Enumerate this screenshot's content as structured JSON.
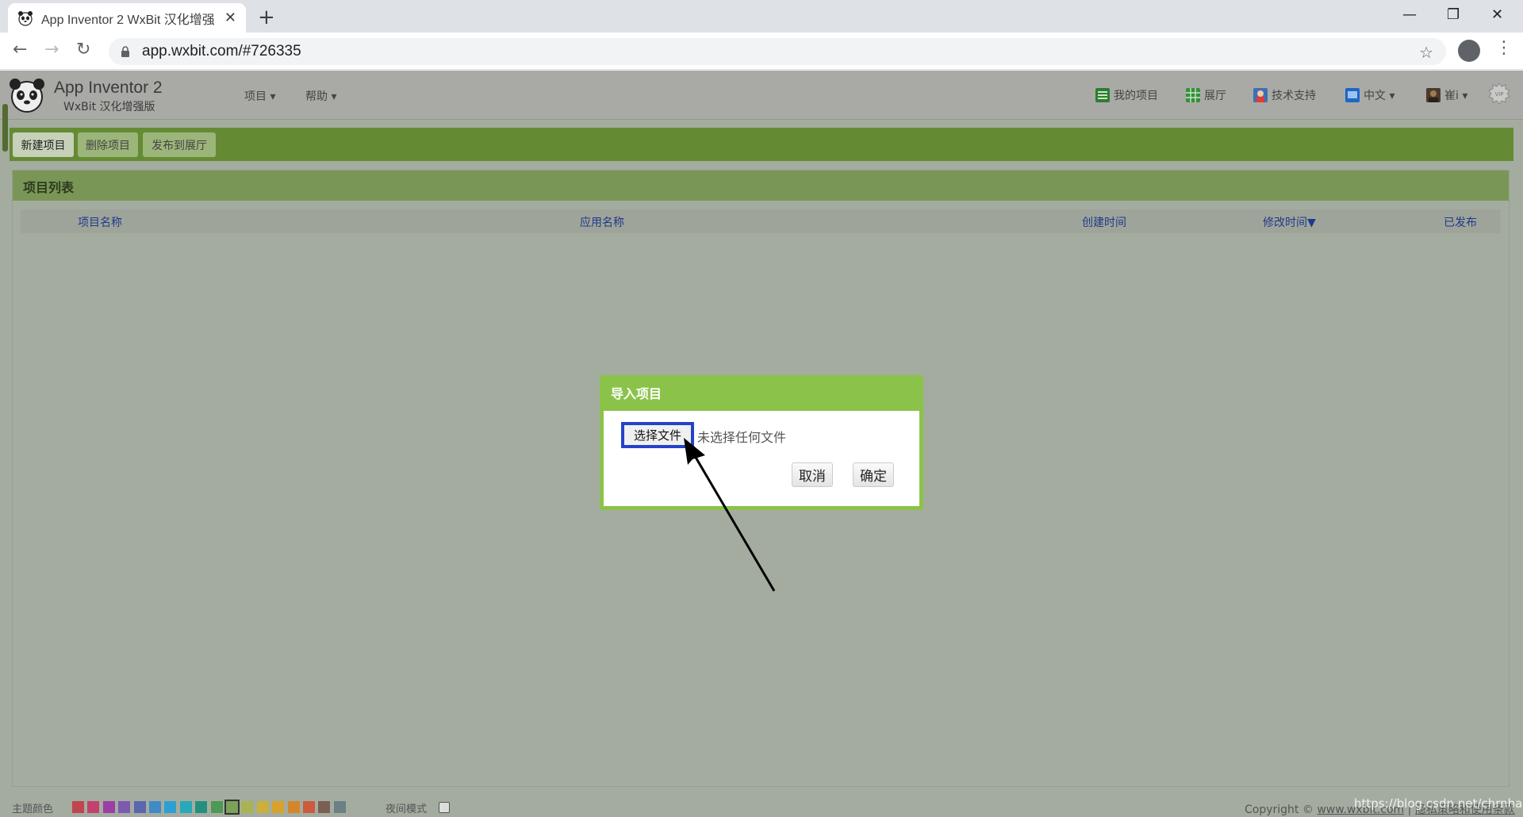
{
  "browser": {
    "tab_title": "App Inventor 2 WxBit 汉化增强",
    "url": "app.wxbit.com/#726335"
  },
  "app": {
    "name": "App Inventor 2",
    "subtitle": "WxBit 汉化增强版",
    "menu": [
      {
        "label": "项目 ▾"
      },
      {
        "label": "帮助 ▾"
      }
    ],
    "right_menu": {
      "my_projects": "我的项目",
      "gallery": "展厅",
      "support": "技术支持",
      "language": "中文 ▾",
      "user": "崔i ▾"
    }
  },
  "toolbar": {
    "new_project": "新建项目",
    "delete_project": "删除项目",
    "publish_gallery": "发布到展厅"
  },
  "project_list": {
    "title": "项目列表",
    "columns": {
      "name": "项目名称",
      "app_name": "应用名称",
      "created": "创建时间",
      "modified": "修改时间▼",
      "published": "已发布"
    }
  },
  "dialog": {
    "title": "导入项目",
    "choose_file": "选择文件",
    "file_status": "未选择任何文件",
    "cancel": "取消",
    "ok": "确定"
  },
  "footer": {
    "theme_label": "主题颜色",
    "night_label": "夜间模式",
    "theme_colors": [
      "#c0454f",
      "#c2416d",
      "#9b3fa6",
      "#7d59b0",
      "#5a66ad",
      "#3f8bc7",
      "#2e9fd3",
      "#26a9b8",
      "#23907f",
      "#4c9a54",
      "#7aa25a",
      "#a9b350",
      "#c9b13a",
      "#d8a32b",
      "#d4862a",
      "#cc5b3c",
      "#7a5f55",
      "#6c8086"
    ],
    "copyright_prefix": "Copyright ©",
    "copyright_link": "www.wxbit.com",
    "copyright_sep": "|",
    "copyright_terms": "隐私策略和使用条款",
    "watermark": "https://blog.csdn.net/chrnhao"
  }
}
